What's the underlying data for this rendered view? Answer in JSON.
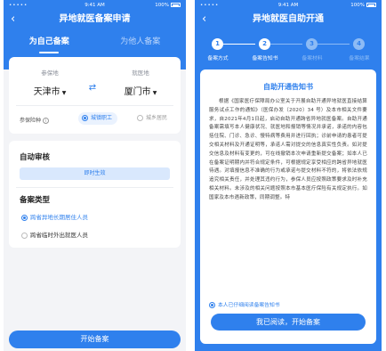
{
  "status": {
    "time": "9:41 AM",
    "battery": "100%",
    "signal": "•••••"
  },
  "left": {
    "title": "异地就医备案申请",
    "tabs": [
      {
        "label": "为自己备案",
        "active": true
      },
      {
        "label": "为他人备案",
        "active": false
      }
    ],
    "insured_place_label": "参保地",
    "insured_place_value": "天津市",
    "medical_place_label": "就医地",
    "medical_place_value": "厦门市",
    "insurance_type_label": "参保险种",
    "insurance_options": [
      {
        "label": "城镇职工",
        "selected": true
      },
      {
        "label": "城乡居民",
        "selected": false
      }
    ],
    "review_title": "自动审核",
    "review_status": "即时生效",
    "record_type_title": "备案类型",
    "record_types": [
      {
        "label": "跨省异地长期居住人员",
        "selected": true
      },
      {
        "label": "跨省临时外出就医人员",
        "selected": false
      }
    ],
    "submit_label": "开始备案"
  },
  "right": {
    "title": "异地就医自助开通",
    "steps": [
      {
        "num": "1",
        "label": "备案方式",
        "done": true
      },
      {
        "num": "2",
        "label": "备案告知书",
        "done": true
      },
      {
        "num": "3",
        "label": "备案材料",
        "done": false
      },
      {
        "num": "4",
        "label": "备案结果",
        "done": false
      }
    ],
    "notice_title": "自助开通告知书",
    "notice_body": "根据《国家医疗保障局办公室关于开展自助开通异地就医直接结算服务试点工作的通知》（医保办发〔2020〕34 号）及本市相关文件要求，自2021年4月1日起，启动自助开通跨省异地就医备案。自助开通备案需填写本人健康状况、就医地和报销等情况并承诺，承诺的内容包括住院、门诊、急诊、慢特病等费用并进行回执；诊前申请的患者可提交相关材料及开通证明等，承诺人需对提交的信息真实性负责。如对提交信息及材料有变更的，可在线撤销本次申请重新提交备案；如本人已在备案证明期内并符合规定条件，可根据规定享受相应的跨省异地就医待遇。对填报信息不准确的行为或承诺与提交材料不符的，将依法依规追究相关责任，并处理其违约行为，参保人员应按照政策要求及时补充相关材料。未涉及的相关问题按照本市基本医疗保险有关规定执行。如国家及本市遇新政策，同期调整。特",
    "agree_label": "本人已仔细阅读备案告知书",
    "read_button_label": "我已阅读，开始备案"
  },
  "colors": {
    "primary": "#2f80ed",
    "background": "#f3f4f7",
    "step_pending": "#8dbbf5"
  }
}
